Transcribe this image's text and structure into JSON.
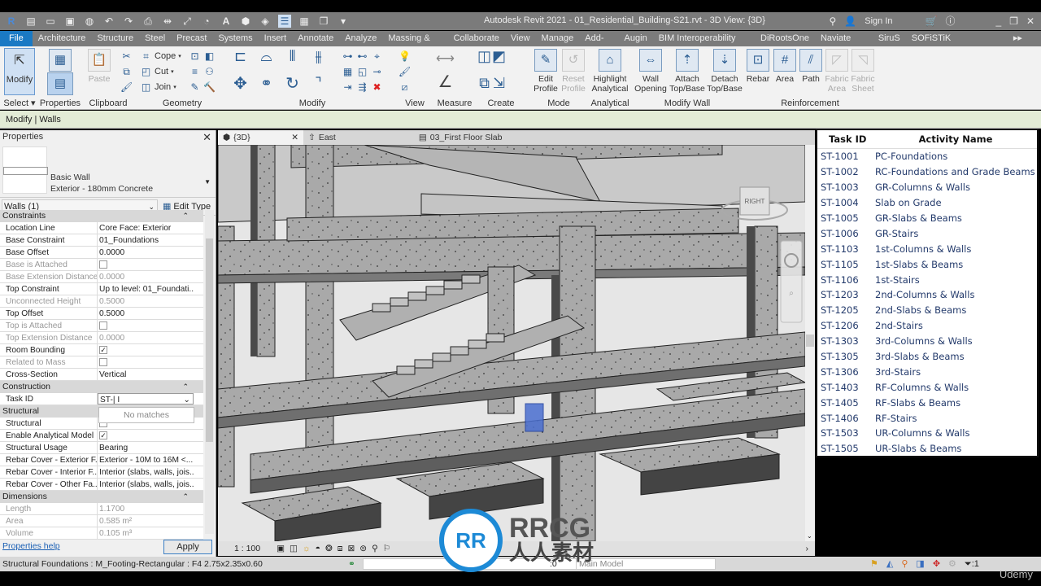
{
  "titlebar": {
    "title": "Autodesk Revit 2021 - 01_Residential_Building-S21.rvt - 3D View: {3D}",
    "sign_in": "Sign In",
    "qat_icons": [
      "revit-logo-icon",
      "home-icon",
      "open-icon",
      "save-icon",
      "sync-icon",
      "undo-icon",
      "redo-icon",
      "print-icon",
      "measure-icon",
      "dimension-icon",
      "tag-icon",
      "text-icon",
      "3d-view-icon",
      "section-icon",
      "thin-lines-icon",
      "close-hidden-icon",
      "switch-windows-icon",
      "customize-icon"
    ]
  },
  "menu": {
    "tabs": [
      "File",
      "Architecture",
      "Structure",
      "Steel",
      "Precast",
      "Systems",
      "Insert",
      "Annotate",
      "Analyze",
      "Massing & Site",
      "Collaborate",
      "View",
      "Manage",
      "Add-Ins",
      "Augin",
      "BIM Interoperability Tools",
      "DiRootsOne",
      "Naviate REX",
      "SiruS",
      "SOFiSTiK Reinforcement"
    ]
  },
  "ribbon": {
    "modify": "Modify",
    "select": "Select ▾",
    "properties": "Properties",
    "paste": "Paste",
    "clipboard": "Clipboard",
    "cope": "Cope",
    "cut": "Cut",
    "join": "Join",
    "geometry": "Geometry",
    "modify_group": "Modify",
    "view_group": "View",
    "measure_group": "Measure",
    "create_group": "Create",
    "edit_profile": "Edit Profile",
    "reset_profile": "Reset Profile",
    "mode_group": "Mode",
    "highlight_analytical": "Highlight Analytical",
    "analytical_group": "Analytical",
    "wall_opening": "Wall Opening",
    "attach_top_base": "Attach Top/Base",
    "detach_top_base": "Detach Top/Base",
    "modify_wall_group": "Modify Wall",
    "rebar": "Rebar",
    "area": "Area",
    "path": "Path",
    "fabric_area": "Fabric Area",
    "fabric_sheet": "Fabric Sheet",
    "reinforcement_group": "Reinforcement"
  },
  "options_bar": {
    "context": "Modify | Walls"
  },
  "properties": {
    "header": "Properties",
    "type_family": "Basic Wall",
    "type_name": "Exterior - 180mm Concrete",
    "instance_selector": "Walls (1)",
    "edit_type": "Edit Type",
    "sections": [
      {
        "name": "Constraints",
        "rows": [
          {
            "key": "Location Line",
            "value": "Core Face: Exterior",
            "enabled": true
          },
          {
            "key": "Base Constraint",
            "value": "01_Foundations",
            "enabled": true
          },
          {
            "key": "Base Offset",
            "value": "0.0000",
            "enabled": true
          },
          {
            "key": "Base is Attached",
            "value": "",
            "checkbox": false,
            "enabled": false
          },
          {
            "key": "Base Extension Distance",
            "value": "0.0000",
            "enabled": false
          },
          {
            "key": "Top Constraint",
            "value": "Up to level: 01_Foundati...",
            "enabled": true
          },
          {
            "key": "Unconnected Height",
            "value": "0.5000",
            "enabled": false
          },
          {
            "key": "Top Offset",
            "value": "0.5000",
            "enabled": true
          },
          {
            "key": "Top is Attached",
            "value": "",
            "checkbox": false,
            "enabled": false
          },
          {
            "key": "Top Extension Distance",
            "value": "0.0000",
            "enabled": false
          },
          {
            "key": "Room Bounding",
            "value": "",
            "checkbox": true,
            "enabled": true
          },
          {
            "key": "Related to Mass",
            "value": "",
            "checkbox": false,
            "enabled": false
          },
          {
            "key": "Cross-Section",
            "value": "Vertical",
            "enabled": true
          }
        ]
      },
      {
        "name": "Construction",
        "rows": [
          {
            "key": "Task ID",
            "value": "ST-",
            "enabled": true,
            "input": true
          }
        ]
      },
      {
        "name": "Structural",
        "rows": [
          {
            "key": "Structural",
            "value": "",
            "checkbox": false,
            "enabled": true
          },
          {
            "key": "Enable Analytical Model",
            "value": "",
            "checkbox": true,
            "enabled": true
          },
          {
            "key": "Structural Usage",
            "value": "Bearing",
            "enabled": true
          },
          {
            "key": "Rebar Cover - Exterior F...",
            "value": "Exterior - 10M to 16M <...",
            "enabled": true
          },
          {
            "key": "Rebar Cover - Interior F...",
            "value": "Interior (slabs, walls, jois...",
            "enabled": true
          },
          {
            "key": "Rebar Cover - Other Fa...",
            "value": "Interior (slabs, walls, jois...",
            "enabled": true
          }
        ]
      },
      {
        "name": "Dimensions",
        "rows": [
          {
            "key": "Length",
            "value": "1.1700",
            "enabled": false
          },
          {
            "key": "Area",
            "value": "0.585 m²",
            "enabled": false
          },
          {
            "key": "Volume",
            "value": "0.105 m³",
            "enabled": false
          }
        ]
      }
    ],
    "dropdown_hint": "No matches",
    "help_link": "Properties help",
    "apply": "Apply"
  },
  "view_tabs": [
    {
      "label": "{3D}",
      "icon": "3d-view-icon",
      "active": true
    },
    {
      "label": "East",
      "icon": "elevation-icon",
      "active": false
    },
    {
      "label": "03_First Floor Slab",
      "icon": "plan-view-icon",
      "active": false
    }
  ],
  "viewcube": {
    "face": "RIGHT"
  },
  "view_bar": {
    "scale": "1 : 100"
  },
  "status_bar": {
    "text": "Structural Foundations : M_Footing-Rectangular : F4 2.75x2.35x0.60",
    "selection_count": ":0",
    "model": "Main Model",
    "filter_count": ":1"
  },
  "task_table": {
    "headers": [
      "Task ID",
      "Activity Name"
    ],
    "rows": [
      [
        "ST-1001",
        "PC-Foundations"
      ],
      [
        "ST-1002",
        "RC-Foundations and Grade Beams"
      ],
      [
        "ST-1003",
        "GR-Columns & Walls"
      ],
      [
        "ST-1004",
        "Slab on Grade"
      ],
      [
        "ST-1005",
        "GR-Slabs & Beams"
      ],
      [
        "ST-1006",
        "GR-Stairs"
      ],
      [
        "ST-1103",
        "1st-Columns & Walls"
      ],
      [
        "ST-1105",
        "1st-Slabs & Beams"
      ],
      [
        "ST-1106",
        "1st-Stairs"
      ],
      [
        "ST-1203",
        "2nd-Columns & Walls"
      ],
      [
        "ST-1205",
        "2nd-Slabs & Beams"
      ],
      [
        "ST-1206",
        "2nd-Stairs"
      ],
      [
        "ST-1303",
        "3rd-Columns & Walls"
      ],
      [
        "ST-1305",
        "3rd-Slabs & Beams"
      ],
      [
        "ST-1306",
        "3rd-Stairs"
      ],
      [
        "ST-1403",
        "RF-Columns & Walls"
      ],
      [
        "ST-1405",
        "RF-Slabs & Beams"
      ],
      [
        "ST-1406",
        "RF-Stairs"
      ],
      [
        "ST-1503",
        "UR-Columns & Walls"
      ],
      [
        "ST-1505",
        "UR-Slabs & Beams"
      ]
    ]
  },
  "watermark": {
    "brand": "RRCG",
    "cn": "人人素材"
  },
  "udemy": "Udemy",
  "colors": {
    "file_tab": "#1a79c4",
    "options_bar": "#e3ecd6",
    "table_text": "#233a6b",
    "selected_element": "#4a6fd0"
  }
}
